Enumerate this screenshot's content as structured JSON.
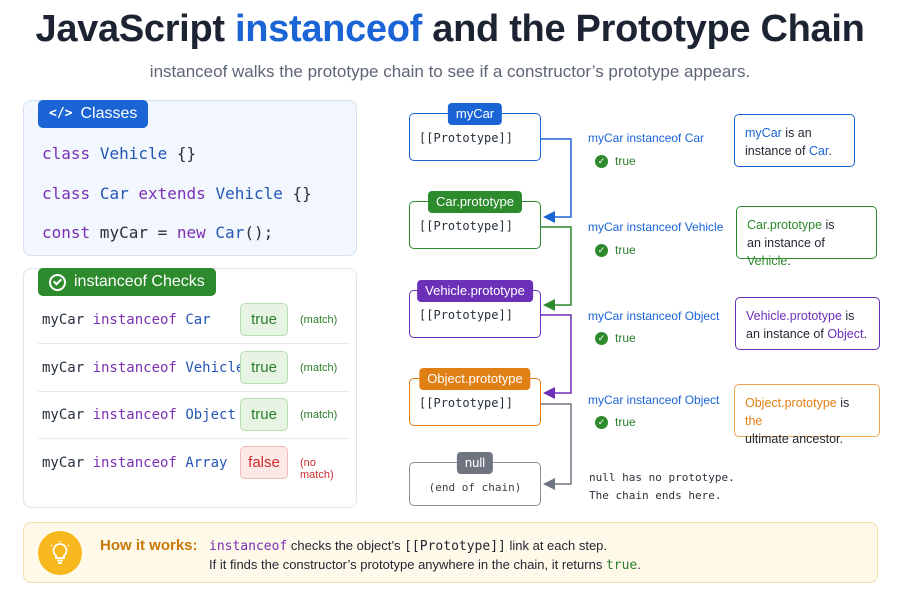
{
  "header": {
    "title_part1": "JavaScript ",
    "title_accent": "instanceof",
    "title_part2": " and the Prototype Chain",
    "subtitle": "instanceof walks the prototype chain to see if a constructor’s prototype appears."
  },
  "classes_panel": {
    "tag_icon": "code-icon",
    "tag_icon_glyph": "</>",
    "tag_label": "Classes",
    "line1": {
      "kw": "class",
      "name": "Vehicle",
      "rest": " {}"
    },
    "line2": {
      "kw": "class",
      "name": "Car",
      "kw2": "extends",
      "name2": "Vehicle",
      "rest": " {}"
    },
    "line3": {
      "kw": "const",
      "var": " myCar = ",
      "kw2": "new",
      "name": "Car",
      "rest": "();"
    }
  },
  "checks_panel": {
    "tag_icon": "check-circle-icon",
    "tag_label": "instanceof Checks",
    "rows": [
      {
        "obj": "myCar ",
        "op": "instanceof",
        "target": "Car",
        "result": "true",
        "note": "(match)"
      },
      {
        "obj": "myCar ",
        "op": "instanceof",
        "target": "Vehicle",
        "result": "true",
        "note": "(match)"
      },
      {
        "obj": "myCar ",
        "op": "instanceof",
        "target": "Object",
        "result": "true",
        "note": "(match)"
      },
      {
        "obj": "myCar ",
        "op": "instanceof",
        "target": "Array",
        "result": "false",
        "note": "(no match)"
      }
    ]
  },
  "chain": {
    "nodes": [
      {
        "label": "myCar",
        "text": "[[Prototype]]",
        "color": "#1a64d6"
      },
      {
        "label": "Car.prototype",
        "text": "[[Prototype]]",
        "color": "#2d8a2d"
      },
      {
        "label": "Vehicle.prototype",
        "text": "[[Prototype]]",
        "color": "#6b2fb8"
      },
      {
        "label": "Object.prototype",
        "text": "[[Prototype]]",
        "color": "#e07f13"
      },
      {
        "label": "null",
        "text": "(end of chain)",
        "color": "#6e7580"
      }
    ],
    "checks": [
      {
        "expr": "myCar instanceof Car",
        "value": "true"
      },
      {
        "expr": "myCar instanceof Vehicle",
        "value": "true"
      },
      {
        "expr": "myCar instanceof Object",
        "value": "true"
      },
      {
        "expr": "myCar instanceof Object",
        "value": "true"
      }
    ],
    "infos": [
      {
        "a": "myCar",
        "b": " is an",
        "c": "instance of ",
        "d": "Car",
        "e": ".",
        "color": "#1a64d6"
      },
      {
        "a": "Car.prototype",
        "b": " is",
        "c": "an instance of ",
        "d": "Vehicle",
        "e": ".",
        "color": "#2d8a2d"
      },
      {
        "a": "Vehicle.prototype",
        "b": " is",
        "c": "an instance of ",
        "d": "Object",
        "e": ".",
        "color": "#6b2fb8"
      },
      {
        "a": "Object.prototype",
        "b": " is ",
        "b2": "the",
        "c": "ultimate ancestor.",
        "color": "#e07f13"
      }
    ],
    "null_note_line1": "null has no prototype.",
    "null_note_line2": "The chain ends here."
  },
  "footer": {
    "icon": "lightbulb-icon",
    "label": "How it works:",
    "line1_code": "instanceof",
    "line1_mid": " checks the object’s ",
    "line1_code2": "[[Prototype]]",
    "line1_end": " link at each step.",
    "line2_text": "If it finds the constructor’s prototype anywhere in the chain, it returns ",
    "line2_code": "true",
    "line2_end": "."
  }
}
